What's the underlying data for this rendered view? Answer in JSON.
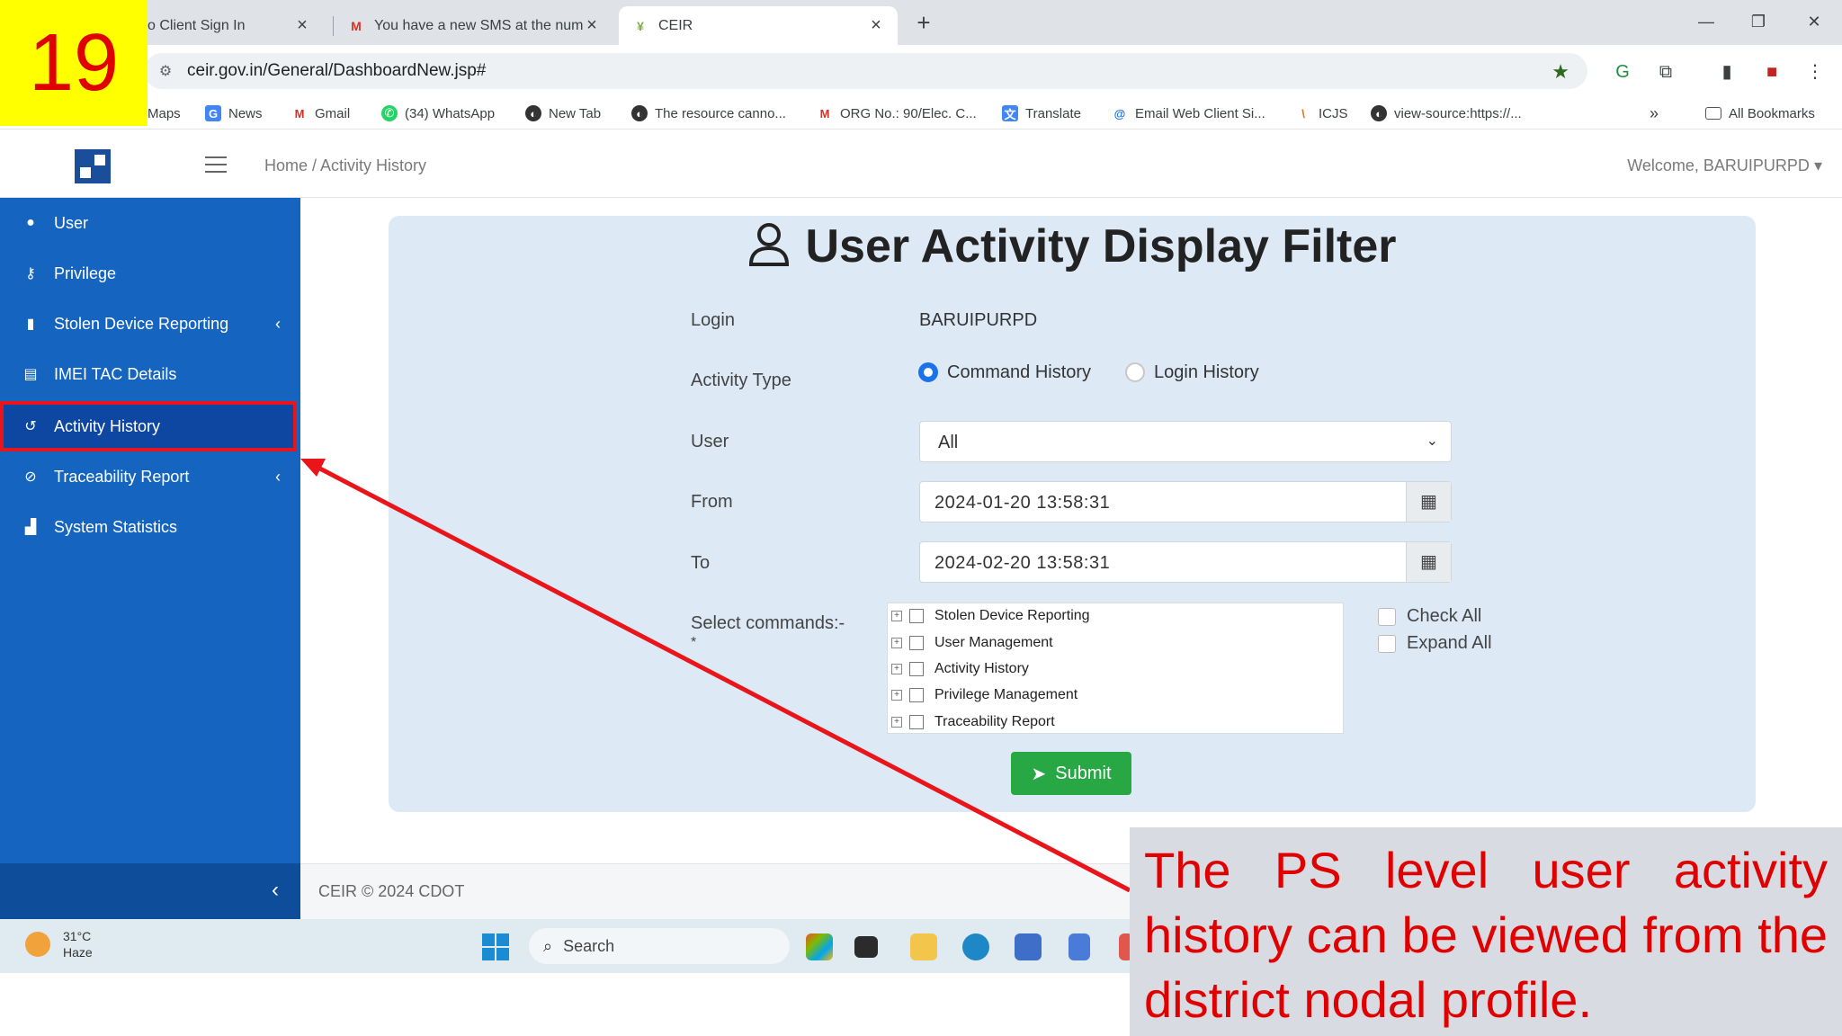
{
  "slide": {
    "number": "19"
  },
  "browser": {
    "tabs": [
      {
        "title": "o Client Sign In"
      },
      {
        "title": "You have a new SMS at the num"
      },
      {
        "title": "CEIR"
      }
    ],
    "url": "ceir.gov.in/General/DashboardNew.jsp#",
    "bookmarks": [
      "Maps",
      "News",
      "Gmail",
      "(34) WhatsApp",
      "New Tab",
      "The resource canno...",
      "ORG No.: 90/Elec. C...",
      "Translate",
      "Email Web Client Si...",
      "ICJS",
      "view-source:https://..."
    ],
    "all_bookmarks": "All Bookmarks"
  },
  "app": {
    "breadcrumb": "Home / Activity History",
    "welcome": "Welcome, BARUIPURPD"
  },
  "sidebar": {
    "items": [
      {
        "label": "User",
        "icon": "user-icon"
      },
      {
        "label": "Privilege",
        "icon": "key-icon"
      },
      {
        "label": "Stolen Device Reporting",
        "icon": "document-icon",
        "has_children": true
      },
      {
        "label": "IMEI TAC Details",
        "icon": "document-icon"
      },
      {
        "label": "Activity History",
        "icon": "history-icon",
        "active": true
      },
      {
        "label": "Traceability Report",
        "icon": "ban-icon",
        "has_children": true
      },
      {
        "label": "System Statistics",
        "icon": "bar-chart-icon"
      }
    ]
  },
  "form": {
    "title": "User Activity Display Filter",
    "login_label": "Login",
    "login_value": "BARUIPURPD",
    "activity_type_label": "Activity Type",
    "activity_options": [
      "Command History",
      "Login History"
    ],
    "activity_selected": "Command History",
    "user_label": "User",
    "user_value": "All",
    "from_label": "From",
    "from_value": "2024-01-20 13:58:31",
    "to_label": "To",
    "to_value": "2024-02-20 13:58:31",
    "commands_label": "Select commands:-",
    "commands_required": "*",
    "commands": [
      "Stolen Device Reporting",
      "User Management",
      "Activity History",
      "Privilege Management",
      "Traceability Report"
    ],
    "check_all": "Check All",
    "expand_all": "Expand All",
    "submit": "Submit"
  },
  "footer": {
    "text": "CEIR © 2024 CDOT"
  },
  "taskbar": {
    "temperature": "31°C",
    "weather": "Haze",
    "search": "Search"
  },
  "caption": {
    "text": "The PS level user activity history can be viewed from the district nodal profile."
  },
  "colors": {
    "sidebar": "#1565c0",
    "annotation": "#e8161b",
    "submit": "#28a745",
    "panel": "#ddeaf6"
  }
}
